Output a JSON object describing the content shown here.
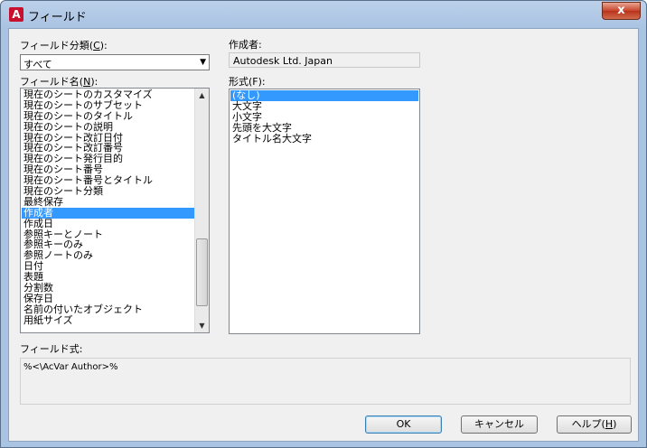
{
  "window": {
    "title": "フィールド",
    "close_glyph": "x",
    "app_icon_glyph": "A"
  },
  "field_category": {
    "label_prefix": "フィールド分類(",
    "label_key": "C",
    "label_suffix": "):",
    "value": "すべて"
  },
  "field_names": {
    "label_prefix": "フィールド名(",
    "label_key": "N",
    "label_suffix": "):",
    "items": [
      "現在のシートのカスタマイズ",
      "現在のシートのサブセット",
      "現在のシートのタイトル",
      "現在のシートの説明",
      "現在のシート改訂日付",
      "現在のシート改訂番号",
      "現在のシート発行目的",
      "現在のシート番号",
      "現在のシート番号とタイトル",
      "現在のシート分類",
      "最終保存",
      "作成者",
      "作成日",
      "参照キーとノート",
      "参照キーのみ",
      "参照ノートのみ",
      "日付",
      "表題",
      "分割数",
      "保存日",
      "名前の付いたオブジェクト",
      "用紙サイズ"
    ],
    "selected_index": 11
  },
  "author": {
    "label": "作成者:",
    "value": "Autodesk Ltd. Japan"
  },
  "format": {
    "label": "形式(F):",
    "items": [
      "(なし)",
      "大文字",
      "小文字",
      "先頭を大文字",
      "タイトル名大文字"
    ],
    "selected_index": 0
  },
  "field_expression": {
    "label": "フィールド式:",
    "value": "%<\\AcVar Author>%"
  },
  "buttons": {
    "ok": "OK",
    "cancel": "キャンセル",
    "help_prefix": "ヘルプ(",
    "help_key": "H",
    "help_suffix": ")"
  },
  "colors": {
    "selection": "#3399ff",
    "client_bg": "#f0f0f0",
    "title_bg": "#a9c3e2",
    "close_red": "#c7452b"
  }
}
